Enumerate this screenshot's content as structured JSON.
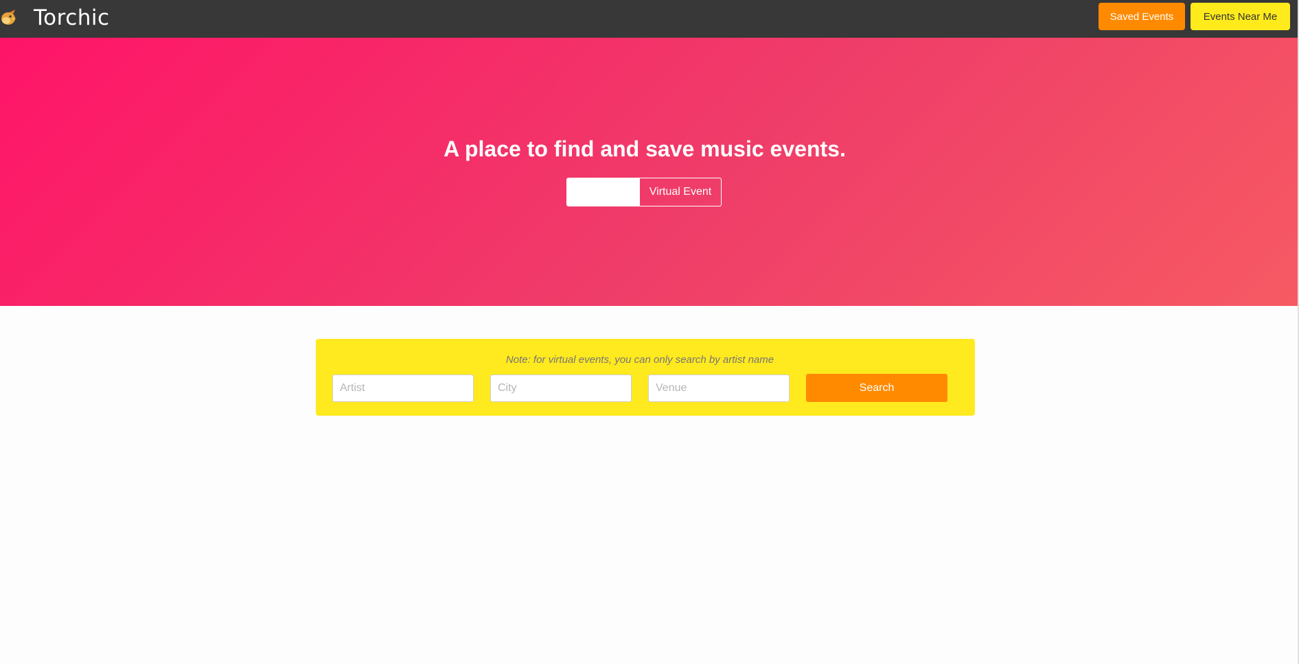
{
  "navbar": {
    "brand": "Torchic",
    "logo_icon": "torchic-logo-icon",
    "saved_events_label": "Saved Events",
    "events_near_me_label": "Events Near Me"
  },
  "hero": {
    "title": "A place to find and save music events.",
    "toggle": {
      "left_label": "",
      "right_label": "Virtual Event"
    }
  },
  "search": {
    "note": "Note: for virtual events, you can only search by artist name",
    "artist_placeholder": "Artist",
    "city_placeholder": "City",
    "venue_placeholder": "Venue",
    "button_label": "Search"
  },
  "colors": {
    "navbar": "#383838",
    "hero_start": "#ff1468",
    "hero_end": "#f75a63",
    "panel": "#ffe91f",
    "orange": "#ff8a00",
    "yellow": "#ffeb1c"
  }
}
